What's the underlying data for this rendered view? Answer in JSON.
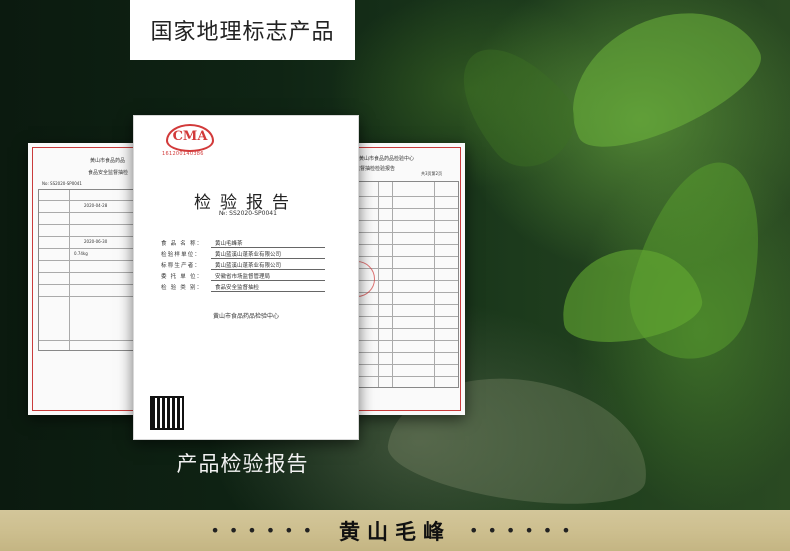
{
  "header": {
    "title": "国家地理标志产品"
  },
  "caption": "产品检验报告",
  "footer": {
    "text": "黄山毛峰",
    "dots": "••••••"
  },
  "report": {
    "cma_logo": "CMA",
    "cma_number": "161200140386",
    "title": "检验报告",
    "number": "№: SS2020-SP0041",
    "fields": [
      {
        "key": "食 品 名 称：",
        "value": "黄山毛峰茶"
      },
      {
        "key": "检验样单位：",
        "value": "黄山蓝溪山蓬茶业有限公司"
      },
      {
        "key": "标称生产者：",
        "value": "黄山蓝溪山蓬茶业有限公司"
      },
      {
        "key": "委 托 单 位：",
        "value": "安徽省市场监督管理局"
      },
      {
        "key": "检 验 类 别：",
        "value": "食品安全监督抽检"
      }
    ],
    "issuer": "黄山市食品药品检验中心"
  },
  "left_doc": {
    "org": "黄山市食品药品",
    "subtitle": "食品安全监督抽检",
    "no": "No: SS2020-SP0041",
    "date1": "2020-04-28",
    "date2": "2020-06-30",
    "qty": "0.74kg"
  },
  "right_doc": {
    "org": "黄山市食品药品检验中心",
    "subtitle": "监督抽检检验报告",
    "page": "共3页第2页"
  }
}
